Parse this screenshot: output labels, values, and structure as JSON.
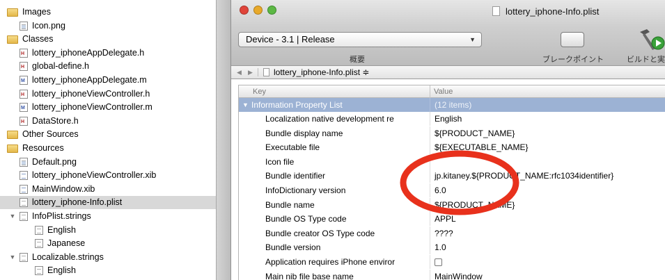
{
  "sidebar": {
    "items": [
      {
        "label": "Images",
        "icon": "folder-icon",
        "level": 0
      },
      {
        "label": "Icon.png",
        "icon": "image-file-icon",
        "level": 1
      },
      {
        "label": "Classes",
        "icon": "folder-icon",
        "level": 0
      },
      {
        "label": "lottery_iphoneAppDelegate.h",
        "icon": "header-file-icon",
        "badge": "H",
        "level": 1
      },
      {
        "label": "global-define.h",
        "icon": "header-file-icon",
        "badge": "H",
        "level": 1
      },
      {
        "label": "lottery_iphoneAppDelegate.m",
        "icon": "implementation-file-icon",
        "badge": "M",
        "level": 1
      },
      {
        "label": "lottery_iphoneViewController.h",
        "icon": "header-file-icon",
        "badge": "H",
        "level": 1
      },
      {
        "label": "lottery_iphoneViewController.m",
        "icon": "implementation-file-icon",
        "badge": "M",
        "level": 1
      },
      {
        "label": "DataStore.h",
        "icon": "header-file-icon",
        "badge": "H",
        "level": 1
      },
      {
        "label": "Other Sources",
        "icon": "folder-icon",
        "level": 0
      },
      {
        "label": "Resources",
        "icon": "folder-icon",
        "level": 0
      },
      {
        "label": "Default.png",
        "icon": "image-file-icon",
        "level": 1
      },
      {
        "label": "lottery_iphoneViewController.xib",
        "icon": "xib-file-icon",
        "level": 1
      },
      {
        "label": "MainWindow.xib",
        "icon": "xib-file-icon",
        "level": 1
      },
      {
        "label": "lottery_iphone-Info.plist",
        "icon": "plist-file-icon",
        "level": 1,
        "selected": true
      },
      {
        "label": "InfoPlist.strings",
        "icon": "strings-file-icon",
        "level": 1,
        "expanded": true
      },
      {
        "label": "English",
        "icon": "strings-file-icon",
        "level": 2
      },
      {
        "label": "Japanese",
        "icon": "strings-file-icon",
        "level": 2
      },
      {
        "label": "Localizable.strings",
        "icon": "strings-file-icon",
        "level": 1,
        "expanded": true
      },
      {
        "label": "English",
        "icon": "strings-file-icon",
        "level": 2
      }
    ]
  },
  "window": {
    "title": "lottery_iphone-Info.plist",
    "traffic_lights": {
      "close": "#e0443a",
      "minimize": "#e8a92a",
      "zoom": "#5cb844"
    }
  },
  "toolbar": {
    "device_select_value": "Device - 3.1 | Release",
    "overview_label": "概要",
    "breakpoints_label": "ブレークポイント",
    "build_label": "ビルドと実"
  },
  "pathbar": {
    "back_icon": "back-arrow-icon",
    "forward_icon": "forward-arrow-icon",
    "file_label": "lottery_iphone-Info.plist ≑"
  },
  "plist": {
    "header_key": "Key",
    "header_value": "Value",
    "root": {
      "key": "Information Property List",
      "value": "(12 items)"
    },
    "rows": [
      {
        "key": "Localization native development re",
        "value": "English"
      },
      {
        "key": "Bundle display name",
        "value": "${PRODUCT_NAME}"
      },
      {
        "key": "Executable file",
        "value": "${EXECUTABLE_NAME}"
      },
      {
        "key": "Icon file",
        "value": ""
      },
      {
        "key": "Bundle identifier",
        "value": "jp.kitaney.${PRODUCT_NAME:rfc1034identifier}"
      },
      {
        "key": "InfoDictionary version",
        "value": "6.0"
      },
      {
        "key": "Bundle name",
        "value": "${PRODUCT_NAME}"
      },
      {
        "key": "Bundle OS Type code",
        "value": "APPL"
      },
      {
        "key": "Bundle creator OS Type code",
        "value": "????"
      },
      {
        "key": "Bundle version",
        "value": "1.0"
      },
      {
        "key": "Application requires iPhone enviror",
        "value": "",
        "checkbox": true
      },
      {
        "key": "Main nib file base name",
        "value": "MainWindow"
      }
    ]
  },
  "colors": {
    "annotation_circle": "#e8311c",
    "selected_row": "#d8d8d8",
    "group_row": "#9cb2d4"
  }
}
